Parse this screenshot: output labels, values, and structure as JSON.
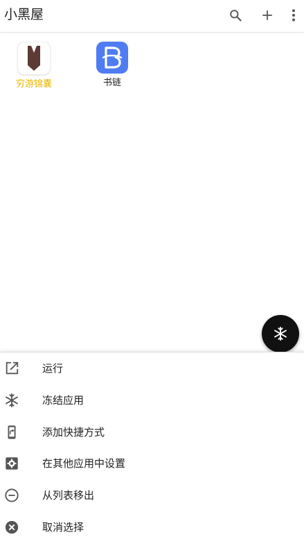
{
  "header": {
    "title": "小黑屋",
    "icons": [
      "search-icon",
      "add-icon",
      "more-vert-icon"
    ]
  },
  "apps": [
    {
      "label": "穷游锦囊",
      "label_color": "#e6b800",
      "icon": "qyer-logo"
    },
    {
      "label": "书链",
      "label_color": "#222222",
      "icon": "shulian-logo",
      "icon_bg": "#4f7cf2"
    }
  ],
  "fab": {
    "icon": "snowflake-icon",
    "color": "#111111"
  },
  "menu": {
    "items": [
      {
        "label": "运行",
        "icon": "open-external-icon"
      },
      {
        "label": "冻结应用",
        "icon": "snowflake-icon"
      },
      {
        "label": "添加快捷方式",
        "icon": "phone-shortcut-icon"
      },
      {
        "label": "在其他应用中设置",
        "icon": "settings-box-icon"
      },
      {
        "label": "从列表移出",
        "icon": "remove-circle-icon"
      },
      {
        "label": "取消选择",
        "icon": "cancel-circle-icon"
      }
    ]
  }
}
